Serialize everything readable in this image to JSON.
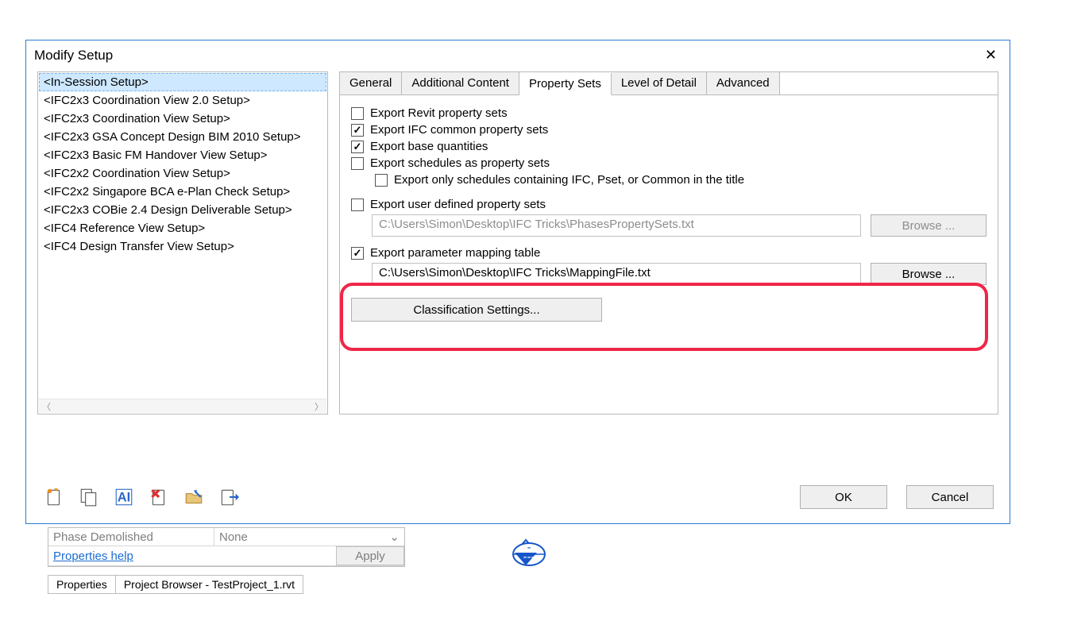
{
  "dialog": {
    "title": "Modify Setup",
    "setups": [
      "<In-Session Setup>",
      "<IFC2x3 Coordination View 2.0 Setup>",
      "<IFC2x3 Coordination View Setup>",
      "<IFC2x3 GSA Concept Design BIM 2010 Setup>",
      "<IFC2x3 Basic FM Handover View Setup>",
      "<IFC2x2 Coordination View Setup>",
      "<IFC2x2 Singapore BCA e-Plan Check Setup>",
      "<IFC2x3 COBie 2.4 Design Deliverable Setup>",
      "<IFC4 Reference View Setup>",
      "<IFC4 Design Transfer View Setup>"
    ],
    "tabs": [
      "General",
      "Additional Content",
      "Property Sets",
      "Level of Detail",
      "Advanced"
    ],
    "active_tab_index": 2,
    "property_sets": {
      "export_revit": {
        "label": "Export Revit property sets",
        "checked": false
      },
      "export_ifc_common": {
        "label": "Export IFC common property sets",
        "checked": true
      },
      "export_base_qty": {
        "label": "Export base quantities",
        "checked": true
      },
      "export_schedules": {
        "label": "Export schedules as property sets",
        "checked": false
      },
      "export_schedules_only_ifc": {
        "label": "Export only schedules containing IFC, Pset, or Common in the title",
        "checked": false
      },
      "export_user_defined": {
        "label": "Export user defined property sets",
        "checked": false
      },
      "user_defined_path": "C:\\Users\\Simon\\Desktop\\IFC Tricks\\PhasesPropertySets.txt",
      "browse_label": "Browse ...",
      "export_param_mapping": {
        "label": "Export parameter mapping table",
        "checked": true
      },
      "param_mapping_path": "C:\\Users\\Simon\\Desktop\\IFC Tricks\\MappingFile.txt",
      "classification_label": "Classification Settings..."
    },
    "ok": "OK",
    "cancel": "Cancel"
  },
  "background": {
    "phase_demolished_label": "Phase Demolished",
    "phase_demolished_value": "None",
    "properties_help": "Properties help",
    "apply": "Apply",
    "bottom_tabs": [
      "Properties",
      "Project Browser - TestProject_1.rvt"
    ]
  }
}
